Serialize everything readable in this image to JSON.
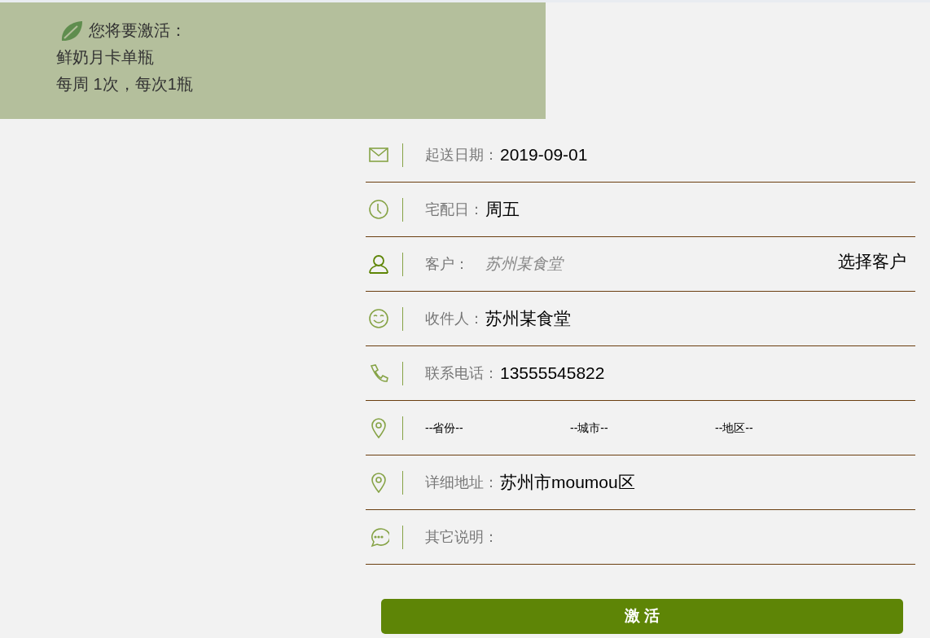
{
  "banner": {
    "heading": "您将要激活：",
    "product": "鲜奶月卡单瓶",
    "schedule": "每周 1次，每次1瓶"
  },
  "rows": [
    {
      "kind": "text",
      "label": "起送日期：",
      "value": "2019-09-01"
    },
    {
      "kind": "text",
      "label": "宅配日：",
      "value": "周五"
    },
    {
      "kind": "picker",
      "label": "客户：",
      "placeholder": "苏州某食堂",
      "action": "选择客户"
    },
    {
      "kind": "text",
      "label": "收件人：",
      "value": "苏州某食堂"
    },
    {
      "kind": "text",
      "label": "联系电话：",
      "value": "13555545822"
    },
    {
      "kind": "selects",
      "options": [
        "--省份--",
        "--城市--",
        "--地区--"
      ]
    },
    {
      "kind": "text",
      "label": "详细地址：",
      "value": "苏州市moumou区"
    },
    {
      "kind": "input",
      "label": "其它说明："
    }
  ],
  "submit": "激 活"
}
